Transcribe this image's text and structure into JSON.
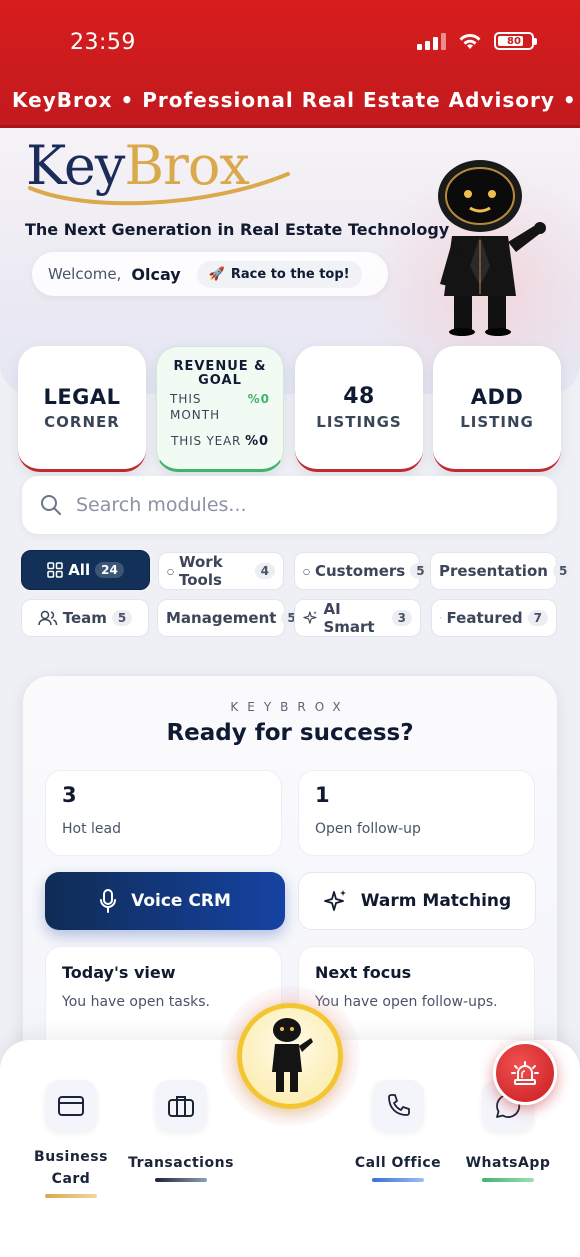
{
  "status_bar": {
    "time": "23:59",
    "battery": "80",
    "battery_level_percent": 80
  },
  "ticker": {
    "text": "KeyBrox • Professional Real Estate Advisory • Reliab"
  },
  "hero": {
    "logo_part1": "Key",
    "logo_part2": "Brox",
    "tagline": "The Next Generation in Real Estate Technology",
    "welcome_label": "Welcome,",
    "user_name": "Olcay",
    "race_chip": "Race to the top!"
  },
  "cards": {
    "legal": {
      "line1": "LEGAL",
      "line2": "CORNER"
    },
    "goal": {
      "title1": "REVENUE &",
      "title2": "GOAL",
      "this_month_a": "THIS",
      "this_month_b": "MONTH",
      "month_value": "%0",
      "this_year": "THIS YEAR",
      "year_value": "%0"
    },
    "listings": {
      "count": "48",
      "label": "LISTINGS"
    },
    "add": {
      "line1": "ADD",
      "line2": "LISTING"
    }
  },
  "search": {
    "placeholder": "Search modules..."
  },
  "filters": [
    {
      "label": "All",
      "count": "24"
    },
    {
      "label": "Work Tools",
      "count": "4"
    },
    {
      "label": "Customers",
      "count": "5"
    },
    {
      "label": "Presentation",
      "count": "5"
    },
    {
      "label": "Team",
      "count": "5"
    },
    {
      "label": "Management",
      "count": "5"
    },
    {
      "label": "AI Smart",
      "count": "3"
    },
    {
      "label": "Featured",
      "count": "7"
    }
  ],
  "panel": {
    "brand": "KEYBROX",
    "title": "Ready for success?",
    "hot_lead_count": "3",
    "hot_lead_label": "Hot lead",
    "followup_count": "1",
    "followup_label": "Open follow-up",
    "voice_crm": "Voice CRM",
    "warm_matching": "Warm Matching",
    "today_title": "Today's view",
    "today_text": "You have open tasks.",
    "focus_title": "Next focus",
    "focus_text": "You have open follow-ups."
  },
  "bottom_nav": {
    "business_card_1": "Business",
    "business_card_2": "Card",
    "transactions": "Transactions",
    "call_office": "Call Office",
    "whatsapp": "WhatsApp"
  },
  "colors": {
    "brand_red": "#c21a1f",
    "navy": "#133158",
    "gold": "#d9a94c",
    "green": "#3fb46a"
  },
  "icons": [
    "signal-icon",
    "wifi-icon",
    "battery-icon",
    "rocket-icon",
    "robot-mascot",
    "search-icon",
    "grid-icon",
    "team-icon",
    "sparkle-icon",
    "flame-icon",
    "microphone-icon",
    "card-icon",
    "briefcase-icon",
    "phone-icon",
    "whatsapp-icon",
    "siren-icon"
  ]
}
